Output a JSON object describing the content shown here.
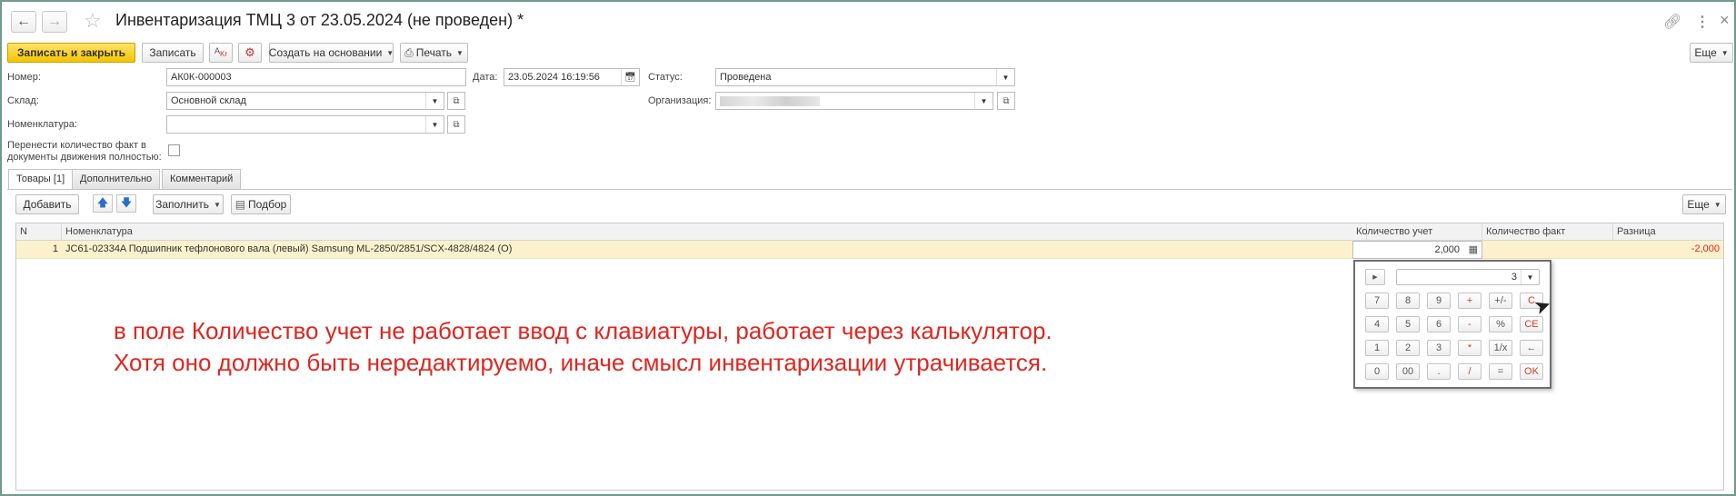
{
  "window": {
    "title": "Инвентаризация ТМЦ 3 от 23.05.2024 (не проведен) *",
    "icons": [
      "back-arrow-icon",
      "forward-arrow-icon",
      "star-icon",
      "link-icon",
      "more-vertical-icon",
      "close-icon"
    ],
    "close_glyph": "×"
  },
  "toolbar": {
    "save_close": "Записать и закрыть",
    "save": "Записать",
    "create_based": "Создать на основании",
    "print": "Печать",
    "more": "Еще"
  },
  "form": {
    "number_label": "Номер:",
    "number_value": "АК0К-000003",
    "date_label": "Дата:",
    "date_value": "23.05.2024 16:19:56",
    "status_label": "Статус:",
    "status_value": "Проведена",
    "warehouse_label": "Склад:",
    "warehouse_value": "Основной склад",
    "org_label": "Организация:",
    "org_value": "",
    "nomenclature_label": "Номенклатура:",
    "nomenclature_value": "",
    "transfer_label_line1": "Перенести количество факт в",
    "transfer_label_line2": "документы движения полностью:"
  },
  "tabs": [
    {
      "label": "Товары [1]",
      "active": true
    },
    {
      "label": "Дополнительно",
      "active": false
    },
    {
      "label": "Комментарий",
      "active": false
    }
  ],
  "table_toolbar": {
    "add": "Добавить",
    "fill": "Заполнить",
    "select": "Подбор",
    "more": "Еще"
  },
  "table": {
    "columns": [
      "N",
      "Номенклатура",
      "Количество учет",
      "Количество факт",
      "Разница"
    ],
    "rows": [
      {
        "n": "1",
        "name": "JC61-02334A Подшипник тефлонового вала (левый) Samsung ML-2850/2851/SCX-4828/4824 (O)",
        "qty_account": "2,000",
        "qty_fact": "",
        "diff": "-2,000"
      }
    ]
  },
  "calculator": {
    "display": "3",
    "rows": [
      [
        "7",
        "8",
        "9",
        "+",
        "+/-",
        "C"
      ],
      [
        "4",
        "5",
        "6",
        "-",
        "%",
        "CE"
      ],
      [
        "1",
        "2",
        "3",
        "*",
        "1/x",
        "←"
      ],
      [
        "0",
        "00",
        ".",
        "/",
        "=",
        "OK"
      ]
    ]
  },
  "annotation": {
    "line1": "в поле Количество учет не работает ввод с клавиатуры, работает через калькулятор.",
    "line2": "Хотя оно должно быть нередактируемо, иначе смысл инвентаризации утрачивается.",
    "color": "#e0261f"
  },
  "colors": {
    "primary_button": "#f5c400",
    "selected_row": "#fbf1cc",
    "negative": "#e0261f"
  }
}
